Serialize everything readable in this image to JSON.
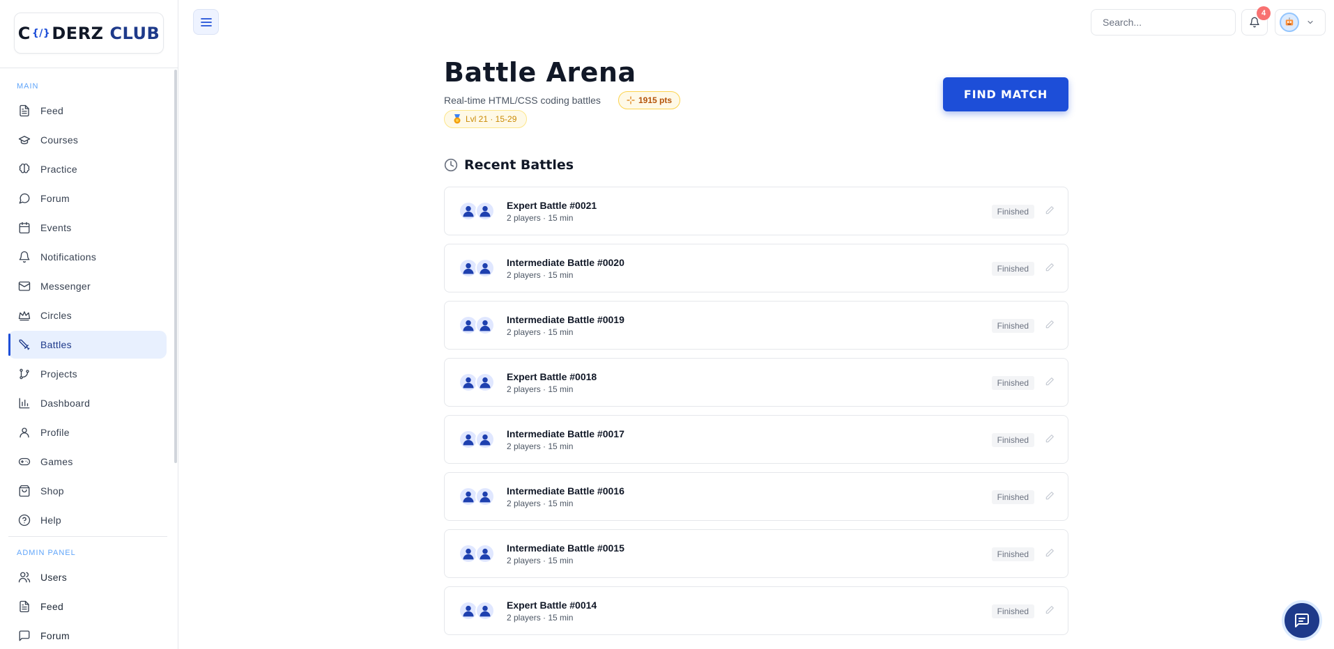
{
  "sidebar": {
    "logo": {
      "left": "C",
      "right": "DERZ",
      "club": "CLUB",
      "mark": "{/}"
    },
    "main_label": "MAIN",
    "items": [
      {
        "label": "Feed",
        "icon": "file-text-icon"
      },
      {
        "label": "Courses",
        "icon": "graduation-cap-icon"
      },
      {
        "label": "Practice",
        "icon": "brain-icon"
      },
      {
        "label": "Forum",
        "icon": "message-circle-icon"
      },
      {
        "label": "Events",
        "icon": "calendar-icon"
      },
      {
        "label": "Notifications",
        "icon": "bell-icon"
      },
      {
        "label": "Messenger",
        "icon": "mail-icon"
      },
      {
        "label": "Circles",
        "icon": "crown-icon"
      },
      {
        "label": "Battles",
        "icon": "sword-icon",
        "active": true
      },
      {
        "label": "Projects",
        "icon": "git-branch-icon"
      },
      {
        "label": "Dashboard",
        "icon": "bar-chart-icon"
      },
      {
        "label": "Profile",
        "icon": "user-icon"
      },
      {
        "label": "Games",
        "icon": "gamepad-icon"
      },
      {
        "label": "Shop",
        "icon": "shopping-bag-icon"
      },
      {
        "label": "Help",
        "icon": "help-circle-icon"
      }
    ],
    "admin_label": "ADMIN PANEL",
    "admin_items": [
      {
        "label": "Users",
        "icon": "users-icon"
      },
      {
        "label": "Feed",
        "icon": "file-text-icon"
      },
      {
        "label": "Forum",
        "icon": "message-square-icon"
      }
    ]
  },
  "topbar": {
    "search_placeholder": "Search...",
    "notification_count": "4"
  },
  "page": {
    "title": "Battle Arena",
    "subtitle": "Real-time HTML/CSS coding battles",
    "points": "1915 pts",
    "level": "Lvl 21 · 15-29",
    "find_match": "FIND MATCH",
    "recent_title": "Recent Battles"
  },
  "battles": [
    {
      "name": "Expert Battle #0021",
      "meta": "2 players · 15 min",
      "status": "Finished"
    },
    {
      "name": "Intermediate Battle #0020",
      "meta": "2 players · 15 min",
      "status": "Finished"
    },
    {
      "name": "Intermediate Battle #0019",
      "meta": "2 players · 15 min",
      "status": "Finished"
    },
    {
      "name": "Expert Battle #0018",
      "meta": "2 players · 15 min",
      "status": "Finished"
    },
    {
      "name": "Intermediate Battle #0017",
      "meta": "2 players · 15 min",
      "status": "Finished"
    },
    {
      "name": "Intermediate Battle #0016",
      "meta": "2 players · 15 min",
      "status": "Finished"
    },
    {
      "name": "Intermediate Battle #0015",
      "meta": "2 players · 15 min",
      "status": "Finished"
    },
    {
      "name": "Expert Battle #0014",
      "meta": "2 players · 15 min",
      "status": "Finished"
    }
  ],
  "colors": {
    "accent": "#1d4ed8",
    "active_bg": "#e8f0fe",
    "badge": "#f87171",
    "chip_border": "#fcd34d"
  }
}
